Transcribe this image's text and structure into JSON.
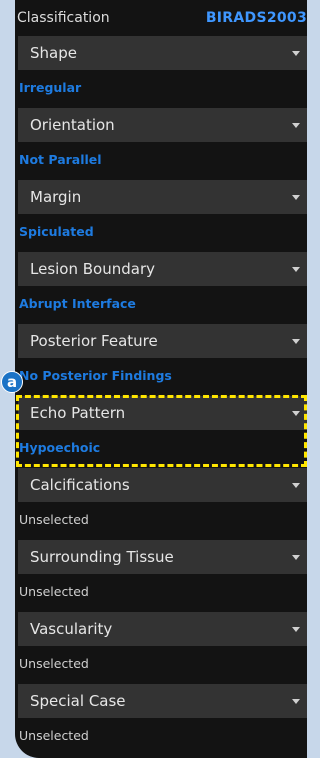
{
  "header": {
    "title": "Classification",
    "standard": "BIRADS2003"
  },
  "sections": [
    {
      "label": "Shape",
      "value": "Irregular"
    },
    {
      "label": "Orientation",
      "value": "Not Parallel"
    },
    {
      "label": "Margin",
      "value": "Spiculated"
    },
    {
      "label": "Lesion Boundary",
      "value": "Abrupt Interface"
    },
    {
      "label": "Posterior Feature",
      "value": "No Posterior Findings"
    },
    {
      "label": "Echo Pattern",
      "value": "Hypoechoic"
    },
    {
      "label": "Calcifications",
      "value": "Unselected"
    },
    {
      "label": "Surrounding Tissue",
      "value": "Unselected"
    },
    {
      "label": "Vascularity",
      "value": "Unselected"
    },
    {
      "label": "Special Case",
      "value": "Unselected"
    }
  ],
  "annotation": {
    "marker": "a",
    "target": "Echo Pattern",
    "color": "#ffe600"
  },
  "colors": {
    "selected": "#1e7be0",
    "unselected": "#cfcfcf",
    "accent": "#3f97ff"
  }
}
